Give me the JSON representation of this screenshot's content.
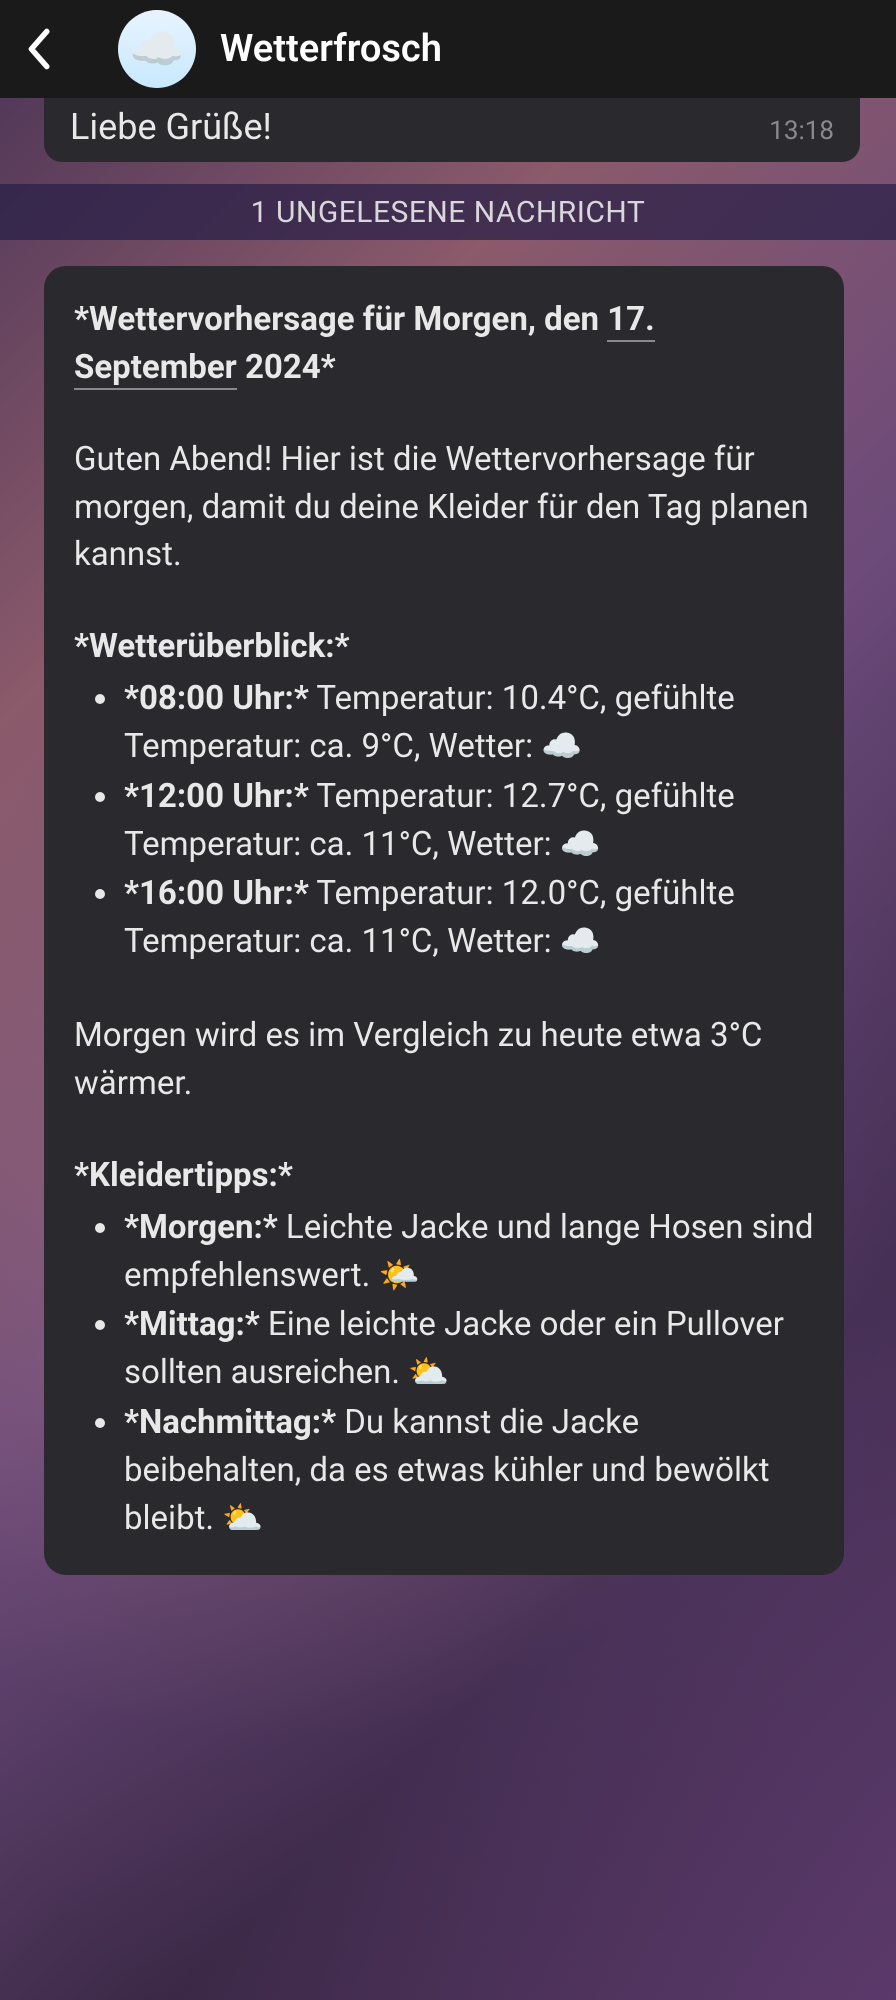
{
  "header": {
    "title": "Wetterfrosch",
    "avatar_emoji": "☁️"
  },
  "previous_message": {
    "text": "Liebe Grüße!",
    "time": "13:18"
  },
  "unread_banner": "1 UNGELESENE NACHRICHT",
  "message": {
    "title_prefix": "*Wettervorhersage für Morgen, den ",
    "title_date": "17. September",
    "title_suffix": " 2024*",
    "intro": "Guten Abend! Hier ist die Wettervorhersage für morgen, damit du deine Kleider für den Tag planen kannst.",
    "overview_heading": "*Wetterüberblick:*",
    "overview": [
      {
        "label": "*08:00 Uhr:*",
        "rest": " Temperatur: 10.4°C, gefühlte Temperatur: ca. 9°C, Wetter: ☁️"
      },
      {
        "label": "*12:00 Uhr:*",
        "rest": " Temperatur: 12.7°C, gefühlte Temperatur: ca. 11°C, Wetter: ☁️"
      },
      {
        "label": "*16:00 Uhr:*",
        "rest": " Temperatur: 12.0°C, gefühlte Temperatur: ca. 11°C, Wetter: ☁️"
      }
    ],
    "comparison": "Morgen wird es im Vergleich zu heute etwa 3°C wärmer.",
    "tips_heading": "*Kleidertipps:*",
    "tips": [
      {
        "label": "*Morgen:*",
        "rest": " Leichte Jacke und lange Hosen sind empfehlenswert. 🌤️"
      },
      {
        "label": "*Mittag:*",
        "rest": " Eine leichte Jacke oder ein Pullover sollten ausreichen. ⛅"
      },
      {
        "label": "*Nachmittag:*",
        "rest": " Du kannst die Jacke beibehalten, da es etwas kühler und bewölkt bleibt. ⛅"
      }
    ]
  }
}
